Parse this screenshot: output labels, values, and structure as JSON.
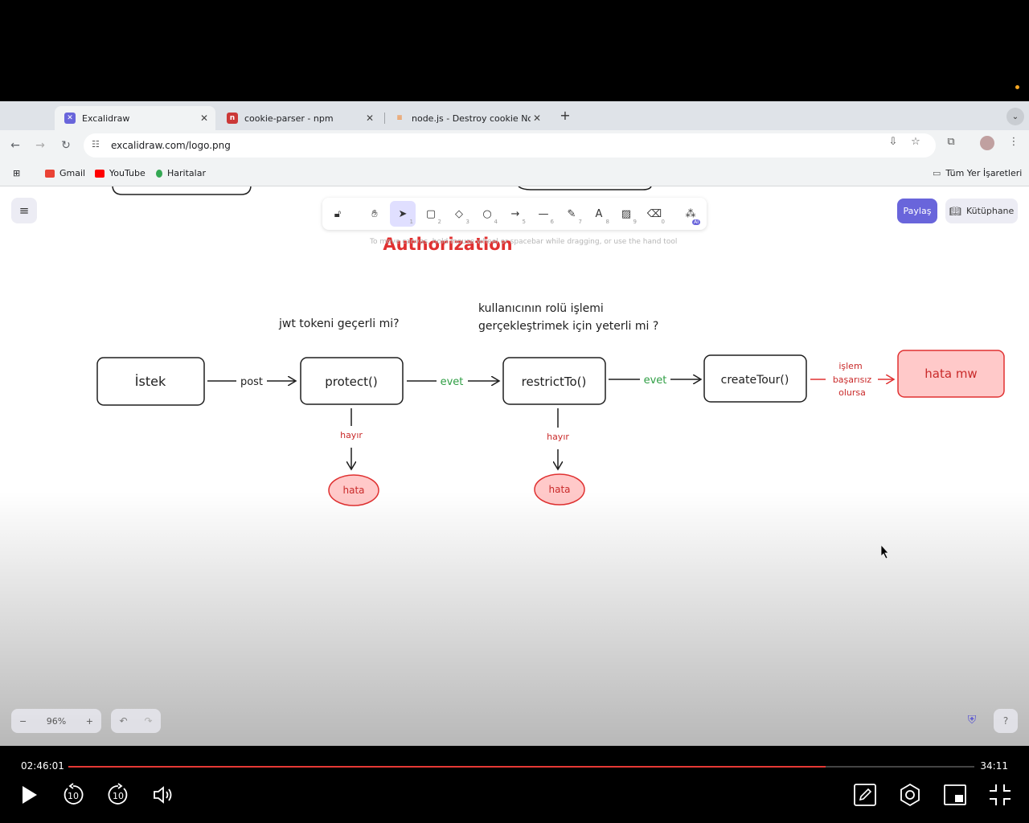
{
  "browser": {
    "tabs": [
      {
        "title": "Excalidraw",
        "active": true,
        "favicon_color": "#6965db"
      },
      {
        "title": "cookie-parser - npm",
        "active": false,
        "favicon_color": "#cb3837"
      },
      {
        "title": "node.js - Destroy cookie Nod",
        "active": false,
        "favicon_color": "#f48024"
      }
    ],
    "new_tab_label": "+",
    "url": "excalidraw.com/logo.png",
    "bookmarks": [
      {
        "label": "Gmail",
        "color": "#ea4335"
      },
      {
        "label": "YouTube",
        "color": "#ff0000"
      },
      {
        "label": "Haritalar",
        "color": "#34a853"
      }
    ],
    "all_bookmarks_label": "Tüm Yer İşaretleri"
  },
  "excalidraw": {
    "tool_keys": [
      "1",
      "2",
      "3",
      "4",
      "5",
      "6",
      "7",
      "8",
      "9",
      "0"
    ],
    "ai_badge": "AI",
    "share_label": "Paylaş",
    "library_label": "Kütüphane",
    "hint": "To move canvas, hold mouse wheel or spacebar while dragging, or use the hand tool",
    "zoom_label": "96%",
    "accent_color": "#6965db"
  },
  "diagram": {
    "title": "Authorization",
    "question_jwt": "jwt tokeni geçerli mi?",
    "question_role_line1": "kullanıcının rolü işlemi",
    "question_role_line2": "gerçekleştrimek için yeterli mi ?",
    "nodes": {
      "request": "İstek",
      "protect": "protect()",
      "restrict": "restrictTo()",
      "create": "createTour()",
      "error_mw": "hata mw",
      "error1": "hata",
      "error2": "hata"
    },
    "edges": {
      "post": "post",
      "yes1": "evet",
      "yes2": "evet",
      "no1": "hayır",
      "no2": "hayır",
      "fail_line1": "işlem",
      "fail_line2": "başarısız",
      "fail_line3": "olursa"
    },
    "colors": {
      "error_fill": "#ffc9c9",
      "error_stroke": "#e03131",
      "error_text": "#c92a2a",
      "yes_text": "#2f9e44",
      "title": "#e03131"
    }
  },
  "player": {
    "current_time": "02:46:01",
    "remaining_time": "34:11",
    "progress": 0.836,
    "skip_back": "10",
    "skip_forward": "10"
  }
}
